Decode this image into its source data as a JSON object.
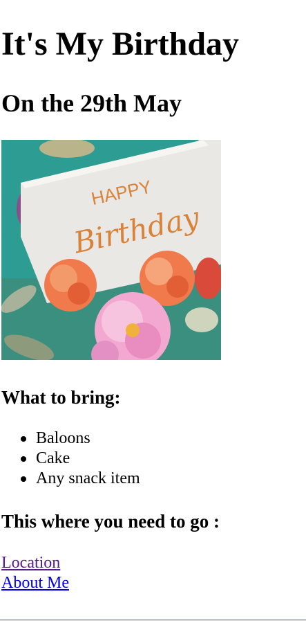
{
  "page": {
    "heading": "It's My Birthday",
    "subheading": "On the 29th May"
  },
  "photo": {
    "card_text_line1": "HAPPY",
    "card_text_line2": "Birthday",
    "background_color": "#2d9d94",
    "card_color": "#e9e8e4",
    "lettering_color": "#d9823a"
  },
  "bring": {
    "heading": "What to bring:",
    "items": [
      "Baloons",
      "Cake",
      "Any snack item"
    ]
  },
  "directions": {
    "heading": "This where you need to go :",
    "links": [
      {
        "label": "Location",
        "visited": true
      },
      {
        "label": "About Me",
        "visited": false
      }
    ]
  }
}
